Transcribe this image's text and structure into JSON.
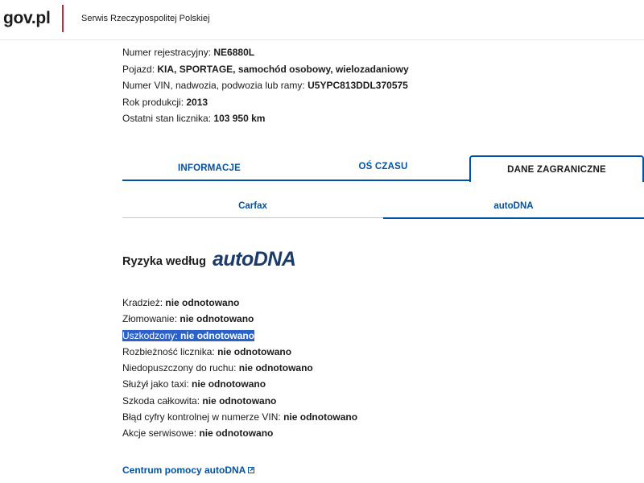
{
  "header": {
    "logo": "gov.pl",
    "service": "Serwis Rzeczypospolitej Polskiej"
  },
  "vehicle": [
    {
      "label": "Numer rejestracyjny:",
      "value": "NE6880L"
    },
    {
      "label": "Pojazd:",
      "value": "KIA, SPORTAGE, samochód osobowy, wielozadaniowy"
    },
    {
      "label": "Numer VIN, nadwozia, podwozia lub ramy:",
      "value": "U5YPC813DDL370575"
    },
    {
      "label": "Rok produkcji:",
      "value": "2013"
    },
    {
      "label": "Ostatni stan licznika:",
      "value": "103 950 km"
    }
  ],
  "tabs": {
    "info": "INFORMACJE",
    "timeline": "OŚ CZASU",
    "foreign": "DANE ZAGRANICZNE",
    "active": "foreign"
  },
  "subtabs": {
    "carfax": "Carfax",
    "autodna": "autoDNA",
    "active": "autodna"
  },
  "risks": {
    "heading": "Ryzyka według",
    "brand": "autoDNA",
    "brand_color": "#1a3a6b",
    "items": [
      {
        "label": "Kradzież:",
        "value": "nie odnotowano"
      },
      {
        "label": "Złomowanie:",
        "value": "nie odnotowano"
      },
      {
        "label": "Uszkodzony:",
        "value": "nie odnotowano"
      },
      {
        "label": "Rozbieżność licznika:",
        "value": "nie odnotowano"
      },
      {
        "label": "Niedopuszczony do ruchu:",
        "value": "nie odnotowano"
      },
      {
        "label": "Służył jako taxi:",
        "value": "nie odnotowano"
      },
      {
        "label": "Szkoda całkowita:",
        "value": "nie odnotowano"
      },
      {
        "label": "Błąd cyfry kontrolnej w numerze VIN:",
        "value": "nie odnotowano"
      },
      {
        "label": "Akcje serwisowe:",
        "value": "nie odnotowano"
      }
    ]
  },
  "help": {
    "link": "Centrum pomocy autoDNA",
    "icon": "external-link-icon"
  },
  "colors": {
    "accent": "#0052a5",
    "logo_divider": "#d4213d",
    "selection": "#2b62c9"
  }
}
